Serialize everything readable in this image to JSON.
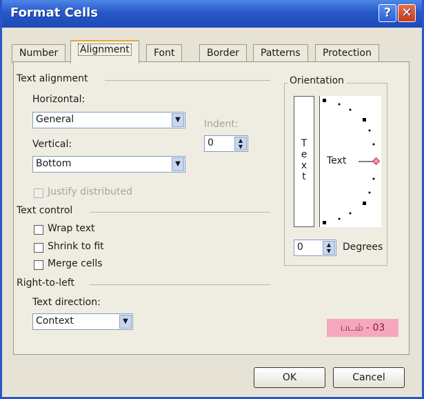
{
  "window": {
    "title": "Format Cells",
    "help_label": "?",
    "close_label": "✕"
  },
  "tabs": [
    {
      "label": "Number",
      "active": false
    },
    {
      "label": "Alignment",
      "active": true
    },
    {
      "label": "Font",
      "active": false
    },
    {
      "label": "Border",
      "active": false
    },
    {
      "label": "Patterns",
      "active": false
    },
    {
      "label": "Protection",
      "active": false
    }
  ],
  "text_alignment": {
    "group_title": "Text alignment",
    "horizontal_label": "Horizontal:",
    "horizontal_value": "General",
    "vertical_label": "Vertical:",
    "vertical_value": "Bottom",
    "indent_label": "Indent:",
    "indent_value": "0",
    "justify_distributed_label": "Justify distributed"
  },
  "text_control": {
    "group_title": "Text control",
    "wrap_text": "Wrap text",
    "shrink_to_fit": "Shrink to fit",
    "merge_cells": "Merge cells"
  },
  "right_to_left": {
    "group_title": "Right-to-left",
    "text_direction_label": "Text direction:",
    "text_direction_value": "Context"
  },
  "orientation": {
    "group_title": "Orientation",
    "vertical_text": [
      "T",
      "e",
      "x",
      "t"
    ],
    "dial_text": "Text",
    "degrees_value": "0",
    "degrees_label": "Degrees"
  },
  "buttons": {
    "ok": "OK",
    "cancel": "Cancel"
  },
  "caption": "படம் - 03",
  "colors": {
    "titlebar": "#2858c8",
    "close_button": "#c43a1a",
    "caption_bg": "#f4a7bd",
    "dial_marker": "#c02050"
  }
}
